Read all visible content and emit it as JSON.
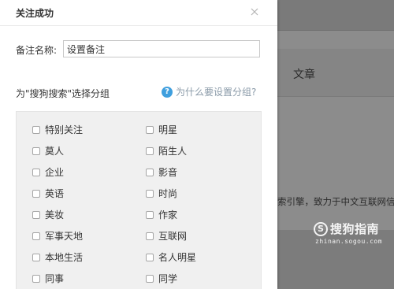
{
  "background": {
    "tab_label": "文章",
    "snippet": "索引擎，致力于中文互联网信",
    "watermark": {
      "logo_glyph": "S",
      "brand": "搜狗指南",
      "domain": "zhinan.sogou.com"
    }
  },
  "dialog": {
    "title": "关注成功",
    "close_icon": "close-icon",
    "remark": {
      "label": "备注名称:",
      "value": "设置备注"
    },
    "group_prompt": "为\"搜狗搜索\"选择分组",
    "why_link": {
      "icon": "?",
      "text": "为什么要设置分组?"
    },
    "groups": [
      [
        "特别关注",
        "明星"
      ],
      [
        "莫人",
        "陌生人"
      ],
      [
        "企业",
        "影音"
      ],
      [
        "英语",
        "时尚"
      ],
      [
        "美妆",
        "作家"
      ],
      [
        "军事天地",
        "互联网"
      ],
      [
        "本地生活",
        "名人明星"
      ],
      [
        "同事",
        "同学"
      ]
    ]
  }
}
